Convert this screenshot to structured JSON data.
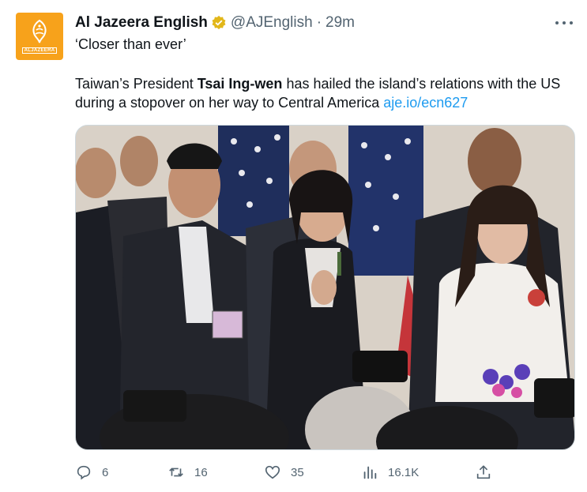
{
  "tweet": {
    "author": {
      "display_name": "Al Jazeera English",
      "handle": "@AJEnglish",
      "time": "29m",
      "avatar_text": "ALJAZEERA"
    },
    "text_line1": "‘Closer than ever’",
    "body_pre": "Taiwan’s President ",
    "body_bold": "Tsai Ing-wen",
    "body_post": " has hailed the island’s relations with the US during a stopover on her way to Central America ",
    "link": "aje.io/ecn627",
    "stats": {
      "replies": "6",
      "retweets": "16",
      "likes": "35",
      "views": "16.1K"
    }
  },
  "icons": {
    "verified": "verified-badge-icon",
    "more": "more-options-icon",
    "reply": "reply-icon",
    "retweet": "retweet-icon",
    "like": "heart-icon",
    "views": "views-chart-icon",
    "share": "share-icon"
  },
  "colors": {
    "accent": "#1d9bf0",
    "secondary_text": "#536471",
    "avatar_bg": "#f7a21b",
    "verified": "#e2b719"
  }
}
